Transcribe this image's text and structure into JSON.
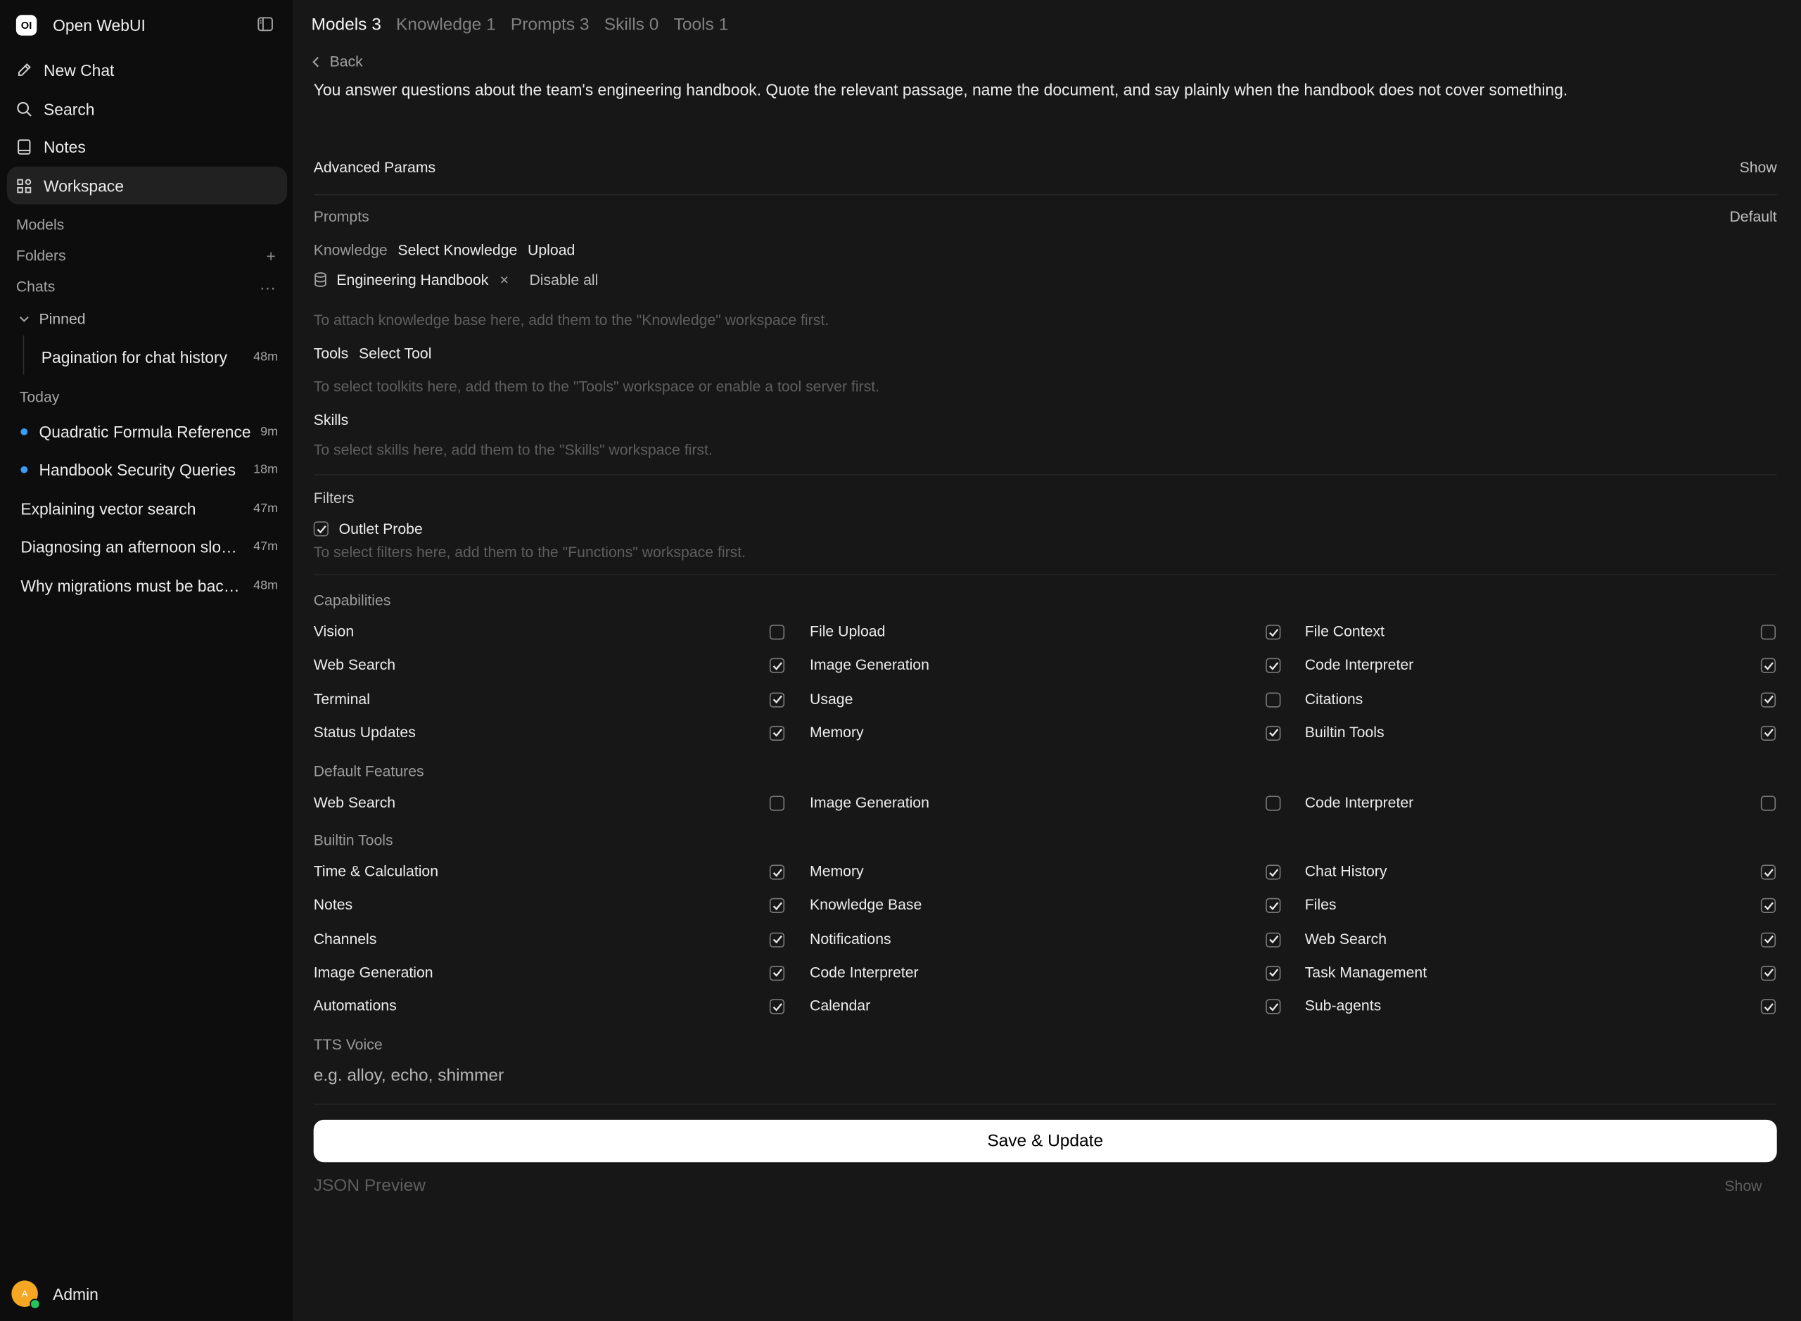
{
  "app": {
    "title": "Open WebUI",
    "logo_text": "OI"
  },
  "sidebar": {
    "nav": [
      {
        "label": "New Chat",
        "icon": "pencil-icon"
      },
      {
        "label": "Search",
        "icon": "search-icon"
      },
      {
        "label": "Notes",
        "icon": "notes-icon"
      },
      {
        "label": "Workspace",
        "icon": "grid-icon"
      }
    ],
    "sections": {
      "models": "Models",
      "folders": "Folders",
      "chats": "Chats",
      "pinned": "Pinned",
      "today": "Today"
    },
    "pinned_chats": [
      {
        "title": "Pagination for chat history",
        "time": "48m"
      }
    ],
    "today_chats": [
      {
        "title": "Quadratic Formula Reference",
        "time": "9m",
        "unread": true
      },
      {
        "title": "Handbook Security Queries",
        "time": "18m",
        "unread": true
      },
      {
        "title": "Explaining vector search",
        "time": "47m",
        "unread": false
      },
      {
        "title": "Diagnosing an afternoon slowdown",
        "time": "47m",
        "unread": false
      },
      {
        "title": "Why migrations must be backward compatible",
        "time": "48m",
        "unread": false
      }
    ],
    "user": {
      "name": "Admin",
      "initial": "A"
    }
  },
  "tabs": [
    {
      "label": "Models",
      "count": "3",
      "active": true
    },
    {
      "label": "Knowledge",
      "count": "1",
      "active": false
    },
    {
      "label": "Prompts",
      "count": "3",
      "active": false
    },
    {
      "label": "Skills",
      "count": "0",
      "active": false
    },
    {
      "label": "Tools",
      "count": "1",
      "active": false
    }
  ],
  "editor": {
    "back": "Back",
    "system_prompt": "You answer questions about the team's engineering handbook. Quote the relevant passage, name the document, and say plainly when the handbook does not cover something.",
    "advanced_params": {
      "label": "Advanced Params",
      "action": "Show"
    },
    "prompts": {
      "label": "Prompts",
      "value": "Default"
    },
    "knowledge": {
      "label": "Knowledge",
      "select": "Select Knowledge",
      "upload": "Upload",
      "item": "Engineering Handbook",
      "remove": "×",
      "disable_all": "Disable all",
      "hint": "To attach knowledge base here, add them to the \"Knowledge\" workspace first."
    },
    "tools": {
      "label": "Tools",
      "select": "Select Tool",
      "hint": "To select toolkits here, add them to the \"Tools\" workspace or enable a tool server first."
    },
    "skills": {
      "label": "Skills",
      "hint": "To select skills here, add them to the \"Skills\" workspace first."
    },
    "filters": {
      "label": "Filters",
      "item": "Outlet Probe",
      "checked": true,
      "hint": "To select filters here, add them to the \"Functions\" workspace first."
    },
    "capabilities": {
      "label": "Capabilities",
      "items": [
        {
          "label": "Vision",
          "checked": false
        },
        {
          "label": "File Upload",
          "checked": true
        },
        {
          "label": "File Context",
          "checked": false
        },
        {
          "label": "Web Search",
          "checked": true
        },
        {
          "label": "Image Generation",
          "checked": true
        },
        {
          "label": "Code Interpreter",
          "checked": true
        },
        {
          "label": "Terminal",
          "checked": true
        },
        {
          "label": "Usage",
          "checked": false
        },
        {
          "label": "Citations",
          "checked": true
        },
        {
          "label": "Status Updates",
          "checked": true
        },
        {
          "label": "Memory",
          "checked": true
        },
        {
          "label": "Builtin Tools",
          "checked": true
        }
      ]
    },
    "default_features": {
      "label": "Default Features",
      "items": [
        {
          "label": "Web Search",
          "checked": false
        },
        {
          "label": "Image Generation",
          "checked": false
        },
        {
          "label": "Code Interpreter",
          "checked": false
        }
      ]
    },
    "builtin_tools": {
      "label": "Builtin Tools",
      "items": [
        {
          "label": "Time & Calculation",
          "checked": true
        },
        {
          "label": "Memory",
          "checked": true
        },
        {
          "label": "Chat History",
          "checked": true
        },
        {
          "label": "Notes",
          "checked": true
        },
        {
          "label": "Knowledge Base",
          "checked": true
        },
        {
          "label": "Files",
          "checked": true
        },
        {
          "label": "Channels",
          "checked": true
        },
        {
          "label": "Notifications",
          "checked": true
        },
        {
          "label": "Web Search",
          "checked": true
        },
        {
          "label": "Image Generation",
          "checked": true
        },
        {
          "label": "Code Interpreter",
          "checked": true
        },
        {
          "label": "Task Management",
          "checked": true
        },
        {
          "label": "Automations",
          "checked": true
        },
        {
          "label": "Calendar",
          "checked": true
        },
        {
          "label": "Sub-agents",
          "checked": true
        }
      ]
    },
    "tts": {
      "label": "TTS Voice",
      "placeholder": "e.g. alloy, echo, shimmer"
    },
    "save_button": "Save & Update",
    "json_preview": {
      "label": "JSON Preview",
      "action": "Show"
    }
  }
}
